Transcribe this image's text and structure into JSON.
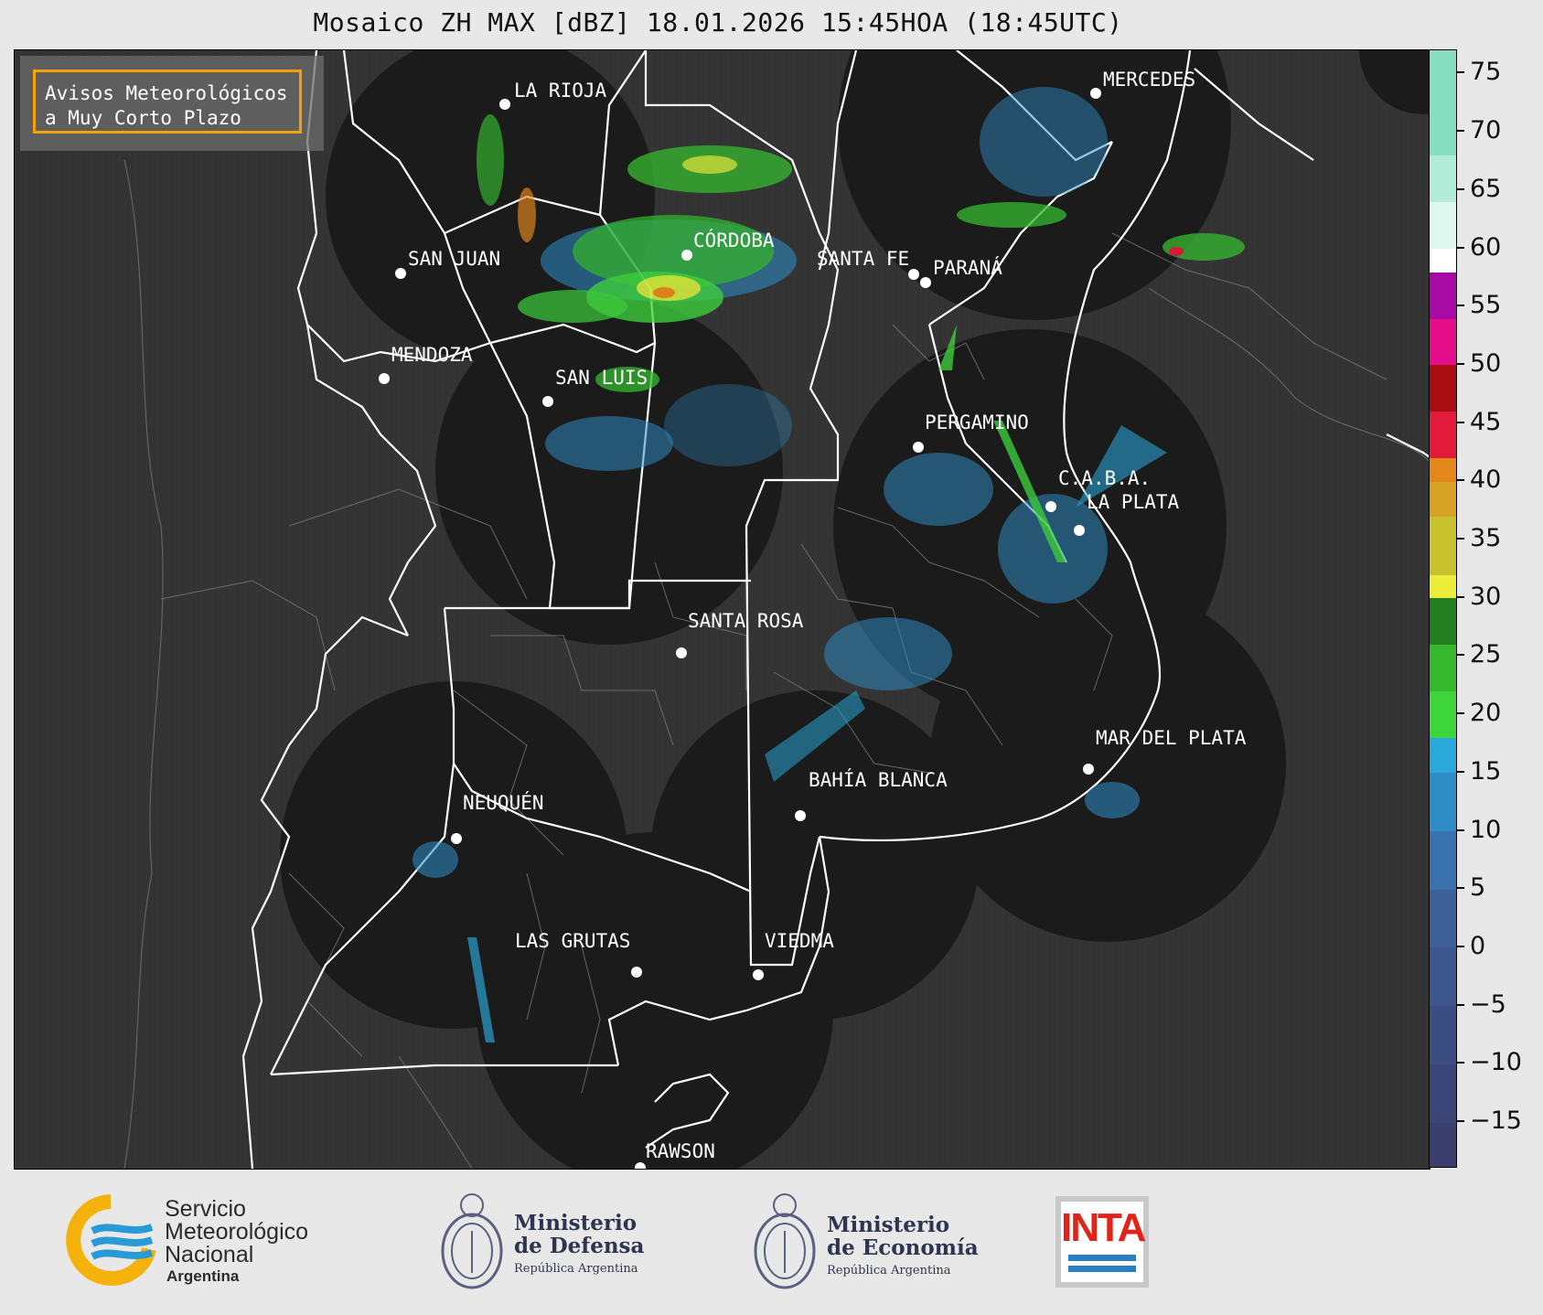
{
  "title": "Mosaico ZH MAX [dBZ] 18.01.2026 15:45HOA (18:45UTC)",
  "badge": {
    "line1": "Avisos Meteorológicos",
    "line2": "a Muy Corto Plazo",
    "border_color": "#f5a10a"
  },
  "cities": [
    {
      "name": "LA RIOJA"
    },
    {
      "name": "MERCEDES"
    },
    {
      "name": "SAN JUAN"
    },
    {
      "name": "CÓRDOBA"
    },
    {
      "name": "SANTA FE"
    },
    {
      "name": "PARANÁ"
    },
    {
      "name": "MENDOZA"
    },
    {
      "name": "SAN LUIS"
    },
    {
      "name": "PERGAMINO"
    },
    {
      "name": "C.A.B.A."
    },
    {
      "name": "LA PLATA"
    },
    {
      "name": "SANTA ROSA"
    },
    {
      "name": "MAR DEL PLATA"
    },
    {
      "name": "BAHÍA BLANCA"
    },
    {
      "name": "NEUQUÉN"
    },
    {
      "name": "LAS GRUTAS"
    },
    {
      "name": "VIEDMA"
    },
    {
      "name": "RAWSON"
    }
  ],
  "colorbar": {
    "min": -19,
    "max": 77,
    "ticks": [
      "75",
      "70",
      "65",
      "60",
      "55",
      "50",
      "45",
      "40",
      "35",
      "30",
      "25",
      "20",
      "15",
      "10",
      "5",
      "0",
      "−5",
      "−10",
      "−15"
    ],
    "tick_values": [
      75,
      70,
      65,
      60,
      55,
      50,
      45,
      40,
      35,
      30,
      25,
      20,
      15,
      10,
      5,
      0,
      -5,
      -10,
      -15
    ],
    "segments": [
      {
        "from": -19,
        "to": -15,
        "color": "#3a3f6e"
      },
      {
        "from": -15,
        "to": -10,
        "color": "#3b4577"
      },
      {
        "from": -10,
        "to": -5,
        "color": "#3c4d82"
      },
      {
        "from": -5,
        "to": 0,
        "color": "#3d568e"
      },
      {
        "from": 0,
        "to": 5,
        "color": "#3e6099"
      },
      {
        "from": 5,
        "to": 10,
        "color": "#3a72ad"
      },
      {
        "from": 10,
        "to": 15,
        "color": "#2f8cc6"
      },
      {
        "from": 15,
        "to": 18,
        "color": "#2aa9dc"
      },
      {
        "from": 18,
        "to": 22,
        "color": "#3fd63d"
      },
      {
        "from": 22,
        "to": 26,
        "color": "#36b82e"
      },
      {
        "from": 26,
        "to": 30,
        "color": "#257d22"
      },
      {
        "from": 30,
        "to": 32,
        "color": "#ecec3a"
      },
      {
        "from": 32,
        "to": 37,
        "color": "#c9c22e"
      },
      {
        "from": 37,
        "to": 40,
        "color": "#d6a324"
      },
      {
        "from": 40,
        "to": 42,
        "color": "#e5861b"
      },
      {
        "from": 42,
        "to": 46,
        "color": "#e21b3c"
      },
      {
        "from": 46,
        "to": 50,
        "color": "#a80d14"
      },
      {
        "from": 50,
        "to": 54,
        "color": "#e60d8a"
      },
      {
        "from": 54,
        "to": 58,
        "color": "#a80aa5"
      },
      {
        "from": 58,
        "to": 60,
        "color": "#ffffff"
      },
      {
        "from": 60,
        "to": 64,
        "color": "#dff7ee"
      },
      {
        "from": 64,
        "to": 68,
        "color": "#b2ecd8"
      },
      {
        "from": 68,
        "to": 77,
        "color": "#86ddc0"
      }
    ]
  },
  "logos": {
    "smn": {
      "line1": "Servicio",
      "line2": "Meteorológico",
      "line3": "Nacional",
      "line4": "Argentina"
    },
    "defensa": {
      "line1": "Ministerio",
      "line2": "de Defensa",
      "line3": "República Argentina"
    },
    "economia": {
      "line1": "Ministerio",
      "line2": "de Economía",
      "line3": "República Argentina"
    },
    "inta": {
      "text": "INTA"
    }
  },
  "colors": {
    "map_background": "#333333",
    "radar_coverage": "#1a1a1a",
    "borders": "#ffffff",
    "inta_red": "#e2231a",
    "inta_blue": "#2a7fc1"
  }
}
